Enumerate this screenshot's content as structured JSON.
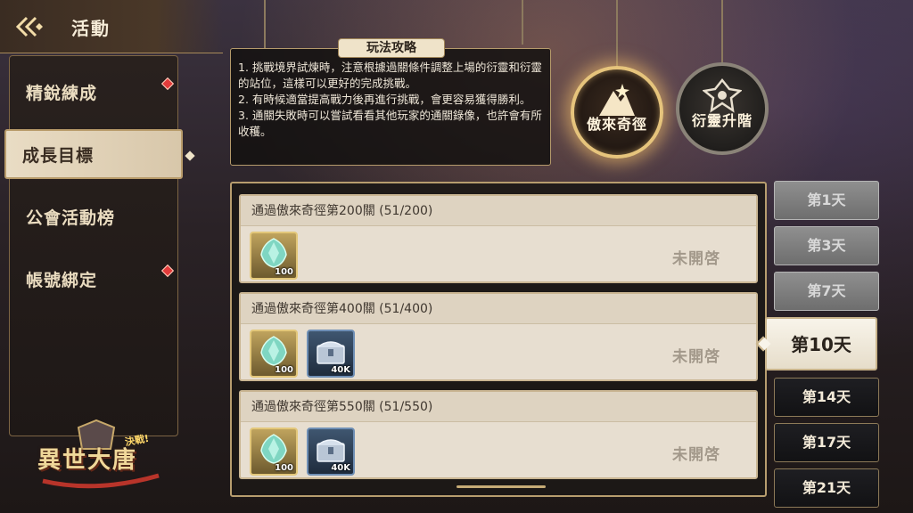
{
  "header": {
    "title": "活動"
  },
  "sidebar": {
    "items": [
      {
        "label": "精銳練成",
        "badge": true
      },
      {
        "label": "成長目標",
        "badge": false,
        "active": true
      },
      {
        "label": "公會活動榜",
        "badge": false
      },
      {
        "label": "帳號綁定",
        "badge": true
      }
    ]
  },
  "logo": {
    "text": "異世大唐",
    "sub": "決戰!"
  },
  "guide": {
    "title": "玩法攻略",
    "lines": [
      "1. 挑戰境界試煉時，注意根據過關條件調整上場的衍靈和衍靈的站位，這樣可以更好的完成挑戰。",
      "2. 有時候適當提高戰力後再進行挑戰，會更容易獲得勝利。",
      "3. 通關失敗時可以嘗試看看其他玩家的通關錄像，也許會有所收穫。"
    ]
  },
  "medallions": [
    {
      "label": "傲來奇徑",
      "icon": "mountain-peak-icon",
      "selected": true
    },
    {
      "label": "衍靈升階",
      "icon": "ornament-emblem-icon",
      "selected": false
    }
  ],
  "tasks": [
    {
      "title": "通過傲來奇徑第200關 (51/200)",
      "status": "未開啓",
      "rewards": [
        {
          "type": "gem",
          "icon": "jade-gem-icon",
          "qty": "100"
        }
      ]
    },
    {
      "title": "通過傲來奇徑第400關 (51/400)",
      "status": "未開啓",
      "rewards": [
        {
          "type": "gem",
          "icon": "jade-gem-icon",
          "qty": "100"
        },
        {
          "type": "chest",
          "icon": "silver-chest-icon",
          "qty": "40K"
        }
      ]
    },
    {
      "title": "通過傲來奇徑第550關 (51/550)",
      "status": "未開啓",
      "rewards": [
        {
          "type": "gem",
          "icon": "jade-gem-icon",
          "qty": "100"
        },
        {
          "type": "chest",
          "icon": "silver-chest-icon",
          "qty": "40K"
        }
      ]
    }
  ],
  "days": [
    {
      "label": "第1天",
      "state": "locked"
    },
    {
      "label": "第3天",
      "state": "locked"
    },
    {
      "label": "第7天",
      "state": "locked"
    },
    {
      "label": "第10天",
      "state": "active"
    },
    {
      "label": "第14天",
      "state": "normal"
    },
    {
      "label": "第17天",
      "state": "normal"
    },
    {
      "label": "第21天",
      "state": "normal"
    }
  ],
  "colors": {
    "accent_gold": "#b79d6e",
    "badge_red": "#e23b3b",
    "task_bg": "#e7ded0",
    "status_gray": "#a2988a"
  }
}
